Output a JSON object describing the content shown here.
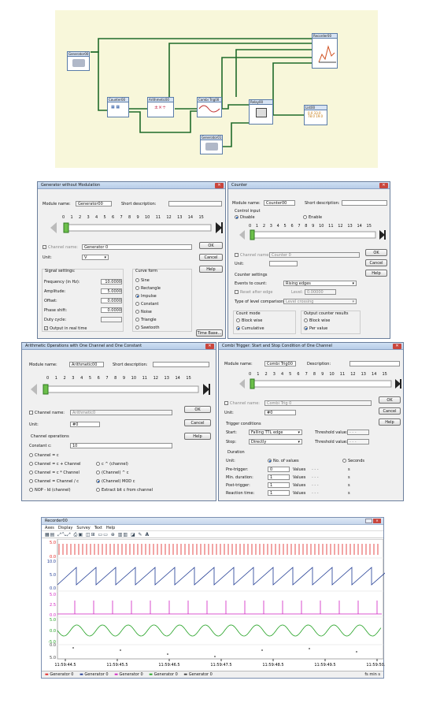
{
  "flow": {
    "generator1": "Generator00",
    "counter": "Counter00",
    "arith": "Arithmetic00",
    "combi": "Combi Trig00",
    "relay": "Relay00",
    "list": "List00",
    "recorder": "Recorder00",
    "generator2": "Generator01",
    "list_values": [
      "0.0",
      "33.0",
      "78.0",
      "19.0"
    ]
  },
  "gen": {
    "title": "Generator without Modulation",
    "module_label": "Module name:",
    "module": "Generator00",
    "short_label": "Short description:",
    "ticks": [
      "0",
      "1",
      "2",
      "3",
      "4",
      "5",
      "6",
      "7",
      "8",
      "9",
      "10",
      "11",
      "12",
      "13",
      "14",
      "15"
    ],
    "ok": "OK",
    "cancel": "Cancel",
    "help": "Help",
    "channel_label": "Channel name:",
    "channel": "Generator 0",
    "unit_label": "Unit:",
    "unit": "V",
    "signal_title": "Signal settings:",
    "freq_label": "Frequency (in Hz):",
    "freq": "10.0000",
    "amp_label": "Amplitude:",
    "amp": "5.0000",
    "offset_label": "Offset:",
    "offset": "0.0000",
    "phase_label": "Phase shift:",
    "phase": "0.0000",
    "duty_label": "Duty cycle:",
    "realtime": "Output in real time",
    "curve_title": "Curve form",
    "curves": [
      "Sine",
      "Rectangle",
      "Impulse",
      "Constant",
      "Noise",
      "Triangle",
      "Sawtooth"
    ],
    "curve_selected": 2,
    "timebase": "Time Base..."
  },
  "cnt": {
    "title": "Counter",
    "module_label": "Module name:",
    "module": "Counter00",
    "short_label": "Short description:",
    "control_title": "Control input",
    "disable": "Disable",
    "enable": "Enable",
    "ok": "OK",
    "cancel": "Cancel",
    "help": "Help",
    "channel_label": "Channel name:",
    "channel": "Counter 0",
    "unit_label": "Unit:",
    "settings_title": "Counter settings",
    "events_label": "Events to count:",
    "events": "Rising edges",
    "reset_label": "Reset after edge",
    "level_label": "Level:",
    "level": "0.00000",
    "type_label": "Type of level comparison:",
    "type": "Level crossing",
    "mode_title": "Count mode",
    "block": "Block wise",
    "cumul": "Cumulative",
    "output_title": "Output counter results",
    "block2": "Block wise",
    "per": "Per value"
  },
  "ari": {
    "title": "Arithmetic Operations with One Channel and One Constant",
    "module_label": "Module name:",
    "module": "Arithmetic00",
    "short_label": "Short description:",
    "ok": "OK",
    "cancel": "Cancel",
    "help": "Help",
    "channel_label": "Channel name:",
    "channel": "Arithmetic0",
    "unit_label": "Unit:",
    "unit": "#0",
    "ops_title": "Channel operations",
    "const_label": "Constant c:",
    "const": "10",
    "ops_left": [
      "Channel = c",
      "Channel = c + Channel",
      "Channel = c * Channel",
      "Channel = Channel / c",
      "NOP - Id (channel)"
    ],
    "ops_right": [
      "c ^ (channel)",
      "(Channel) ^ c",
      "(Channel) MOD c",
      "Extract bit c from channel"
    ]
  },
  "cmb": {
    "title": "Combi Trigger: Start and Stop Condition of One Channel",
    "module_label": "Module name:",
    "module": "Combi Trig00",
    "desc_label": "Description:",
    "ok": "OK",
    "cancel": "Cancel",
    "help": "Help",
    "channel_label": "Channel name:",
    "channel": "Combi Trig 0",
    "unit_label": "Unit:",
    "unit": "#0",
    "trig_title": "Trigger conditions",
    "start_label": "Start:",
    "start": "Falling TTL edge",
    "stop_label": "Stop:",
    "stop": "Directly",
    "thr_label": "Threshold value:",
    "thr": "- - -",
    "dur_title": "Duration",
    "unit2_label": "Unit:",
    "nov": "No. of values",
    "sec": "Seconds",
    "rows": [
      {
        "l": "Pre-trigger:",
        "v": "0"
      },
      {
        "l": "Min. duration:",
        "v": "1"
      },
      {
        "l": "Post-trigger:",
        "v": "1"
      },
      {
        "l": "Reaction time:",
        "v": "1"
      }
    ],
    "values_word": "Values",
    "dashes": "- - -",
    "s": "s"
  },
  "rec": {
    "title": "Recorder00",
    "menu": [
      "Axes",
      "Display",
      "Survey",
      "Text",
      "Help"
    ],
    "times": [
      "11:59:44.5",
      "11:59:45.5",
      "11:59:46.5",
      "11:59:47.5",
      "11:59:48.5",
      "11:59:49.5",
      "11:59:50.5"
    ],
    "legend": [
      "Generator 0",
      "Generator 0",
      "Generator 0",
      "Generator 0",
      "Generator 0"
    ],
    "zoom": "fs min s",
    "axes": [
      {
        "ticks": [
          "5.0",
          "0.0"
        ],
        "color": "#e02020"
      },
      {
        "ticks": [
          "10.0",
          "5.0",
          "0.0"
        ],
        "color": "#1f3a93"
      },
      {
        "ticks": [
          "5.0",
          "2.5",
          "0.0"
        ],
        "color": "#d020c0"
      },
      {
        "ticks": [
          "5.0",
          "0.0",
          "-5.0"
        ],
        "color": "#20a020"
      },
      {
        "ticks": [
          "0.0",
          "5.0"
        ],
        "color": "#404040"
      }
    ]
  }
}
